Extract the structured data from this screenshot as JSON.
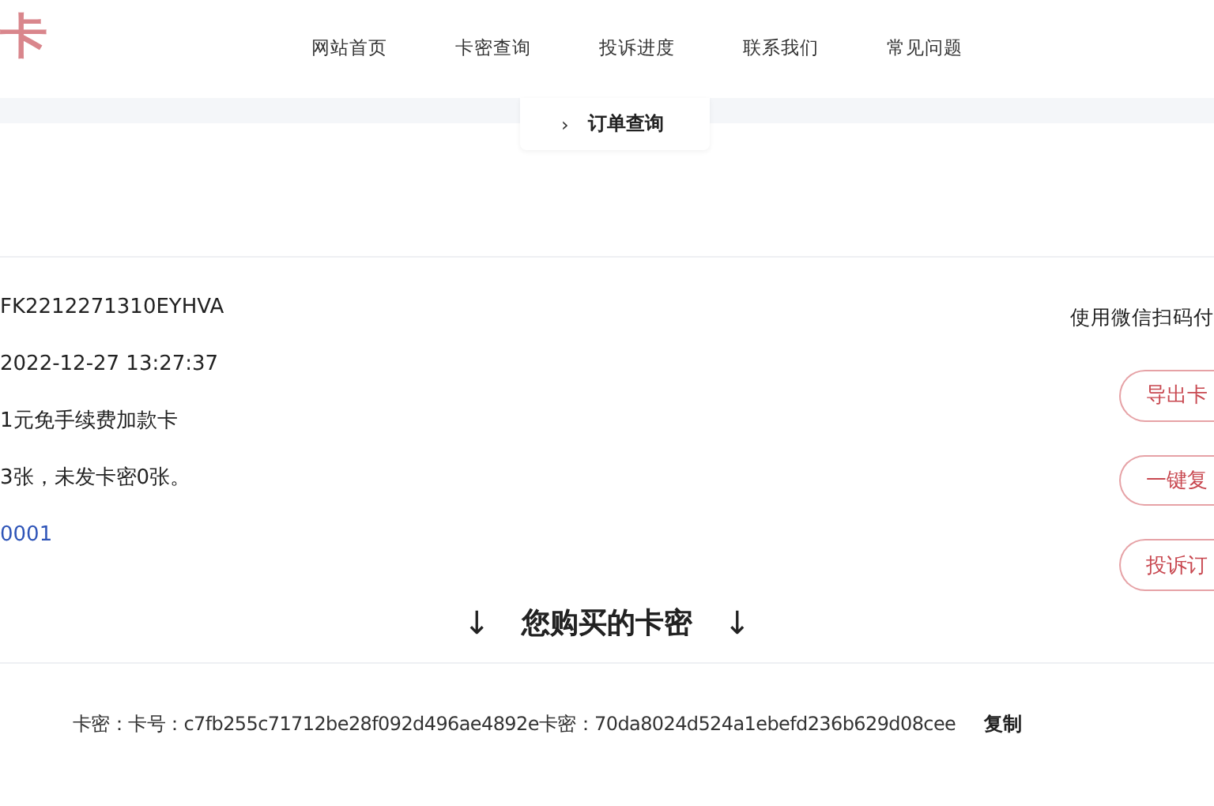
{
  "logo": {
    "text": "卡"
  },
  "nav": [
    {
      "label": "网站首页"
    },
    {
      "label": "卡密查询"
    },
    {
      "label": "投诉进度"
    },
    {
      "label": "联系我们"
    },
    {
      "label": "常见问题"
    }
  ],
  "breadcrumb": {
    "separator": "›",
    "label": "订单查询"
  },
  "order": {
    "lines": [
      {
        "text": "FK2212271310EYHVA",
        "kind": "plain"
      },
      {
        "text": "2022-12-27 13:27:37",
        "kind": "plain"
      },
      {
        "text": "1元免手续费加款卡",
        "kind": "plain"
      },
      {
        "text": "3张，未发卡密0张。",
        "kind": "plain"
      },
      {
        "text": "0001",
        "kind": "link"
      }
    ],
    "pay_note": "使用微信扫码付",
    "buttons": [
      {
        "label": "导出卡"
      },
      {
        "label": "一键复"
      },
      {
        "label": "投诉订"
      }
    ]
  },
  "cards": {
    "arrow_left": "↓",
    "title": "您购买的卡密",
    "arrow_right": "↓",
    "line": "卡密：卡号：c7fb255c71712be28f092d496ae4892e卡密：70da8024d524a1ebefd236b629d08cee",
    "copy": "复制"
  }
}
